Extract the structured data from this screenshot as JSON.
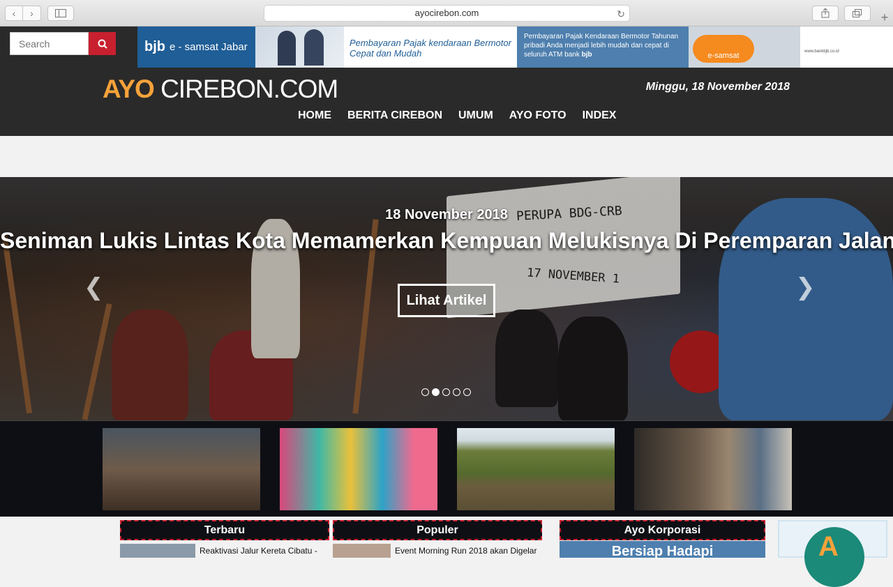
{
  "browser": {
    "url": "ayocirebon.com",
    "back_icon": "chevron-left-icon",
    "forward_icon": "chevron-right-icon"
  },
  "header": {
    "search_placeholder": "Search",
    "logo_part1": "AYO",
    "logo_part2": " CIREBON.COM",
    "date": "Minggu, 18 November 2018",
    "nav": [
      "HOME",
      "BERITA CIREBON",
      "UMUM",
      "AYO FOTO",
      "INDEX"
    ]
  },
  "ad_banner": {
    "brand": "bjb",
    "brand_sub": "e - samsat Jabar",
    "headline": "Pembayaran Pajak kendaraan Bermotor Cepat dan Mudah",
    "body_pre": "Pembayaran Pajak Kendaraan Bermotor Tahunan pribadi Anda menjadi lebih mudah dan cepat di seluruh ATM bank ",
    "body_brand": "bjb",
    "badge": "e-samsat",
    "footer": "www.bankbjb.co.id"
  },
  "hero": {
    "date": "18 November 2018",
    "title": "Seniman Lukis Lintas Kota Memamerkan Kempuan Melukisnya Di Peremparan Jalan",
    "button": "Lihat Artikel",
    "banner_text_1": "PERUPA BDG-CRB",
    "banner_text_2": "17 NOVEMBER 1",
    "slide_count": 5,
    "active_slide": 2
  },
  "sections": {
    "terbaru": {
      "title": "Terbaru",
      "first_item": "Reaktivasi Jalur Kereta Cibatu -"
    },
    "populer": {
      "title": "Populer",
      "first_item": "Event Morning Run 2018 akan Digelar"
    },
    "korporasi": {
      "title": "Ayo Korporasi",
      "first_item": "Bersiap Hadapi"
    }
  },
  "colors": {
    "accent": "#c8202f",
    "logo_orange": "#f6a23a",
    "header_bg": "#2a2a2a",
    "strip_bg": "#0e0f14"
  }
}
